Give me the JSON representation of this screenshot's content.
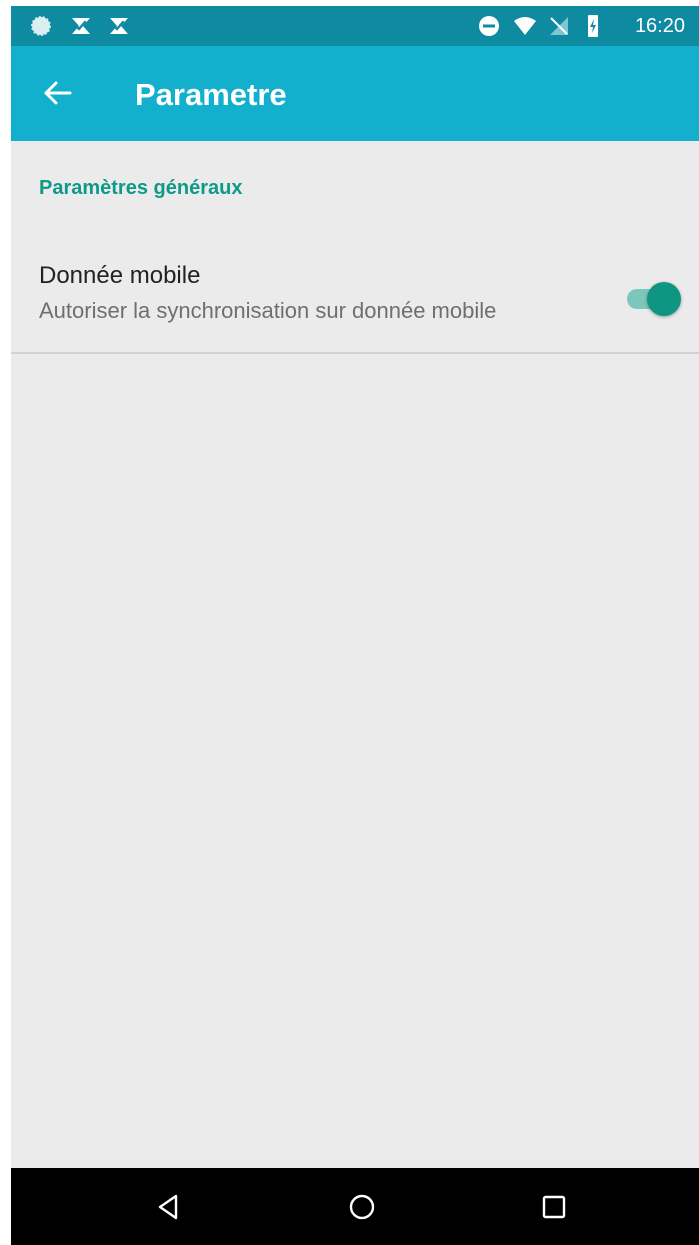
{
  "status_bar": {
    "time": "16:20",
    "left_icons": [
      "spinner-icon",
      "check-notification-icon",
      "check-notification-icon"
    ],
    "right_icons": [
      "do-not-disturb-icon",
      "wifi-icon",
      "no-sim-icon",
      "battery-charging-icon"
    ]
  },
  "app_bar": {
    "title": "Parametre",
    "back_icon": "arrow-back-icon",
    "color": "#12b0cc"
  },
  "settings": {
    "section_header": "Paramètres généraux",
    "items": [
      {
        "title": "Donnée mobile",
        "summary": "Autoriser la synchronisation sur donnée mobile",
        "toggle_on": true
      }
    ]
  },
  "nav_bar": {
    "buttons": [
      "back-triangle-icon",
      "home-circle-icon",
      "recents-square-icon"
    ]
  },
  "colors": {
    "status_bar": "#0e8aa1",
    "accent": "#0f9a88",
    "background": "#ebebeb"
  }
}
